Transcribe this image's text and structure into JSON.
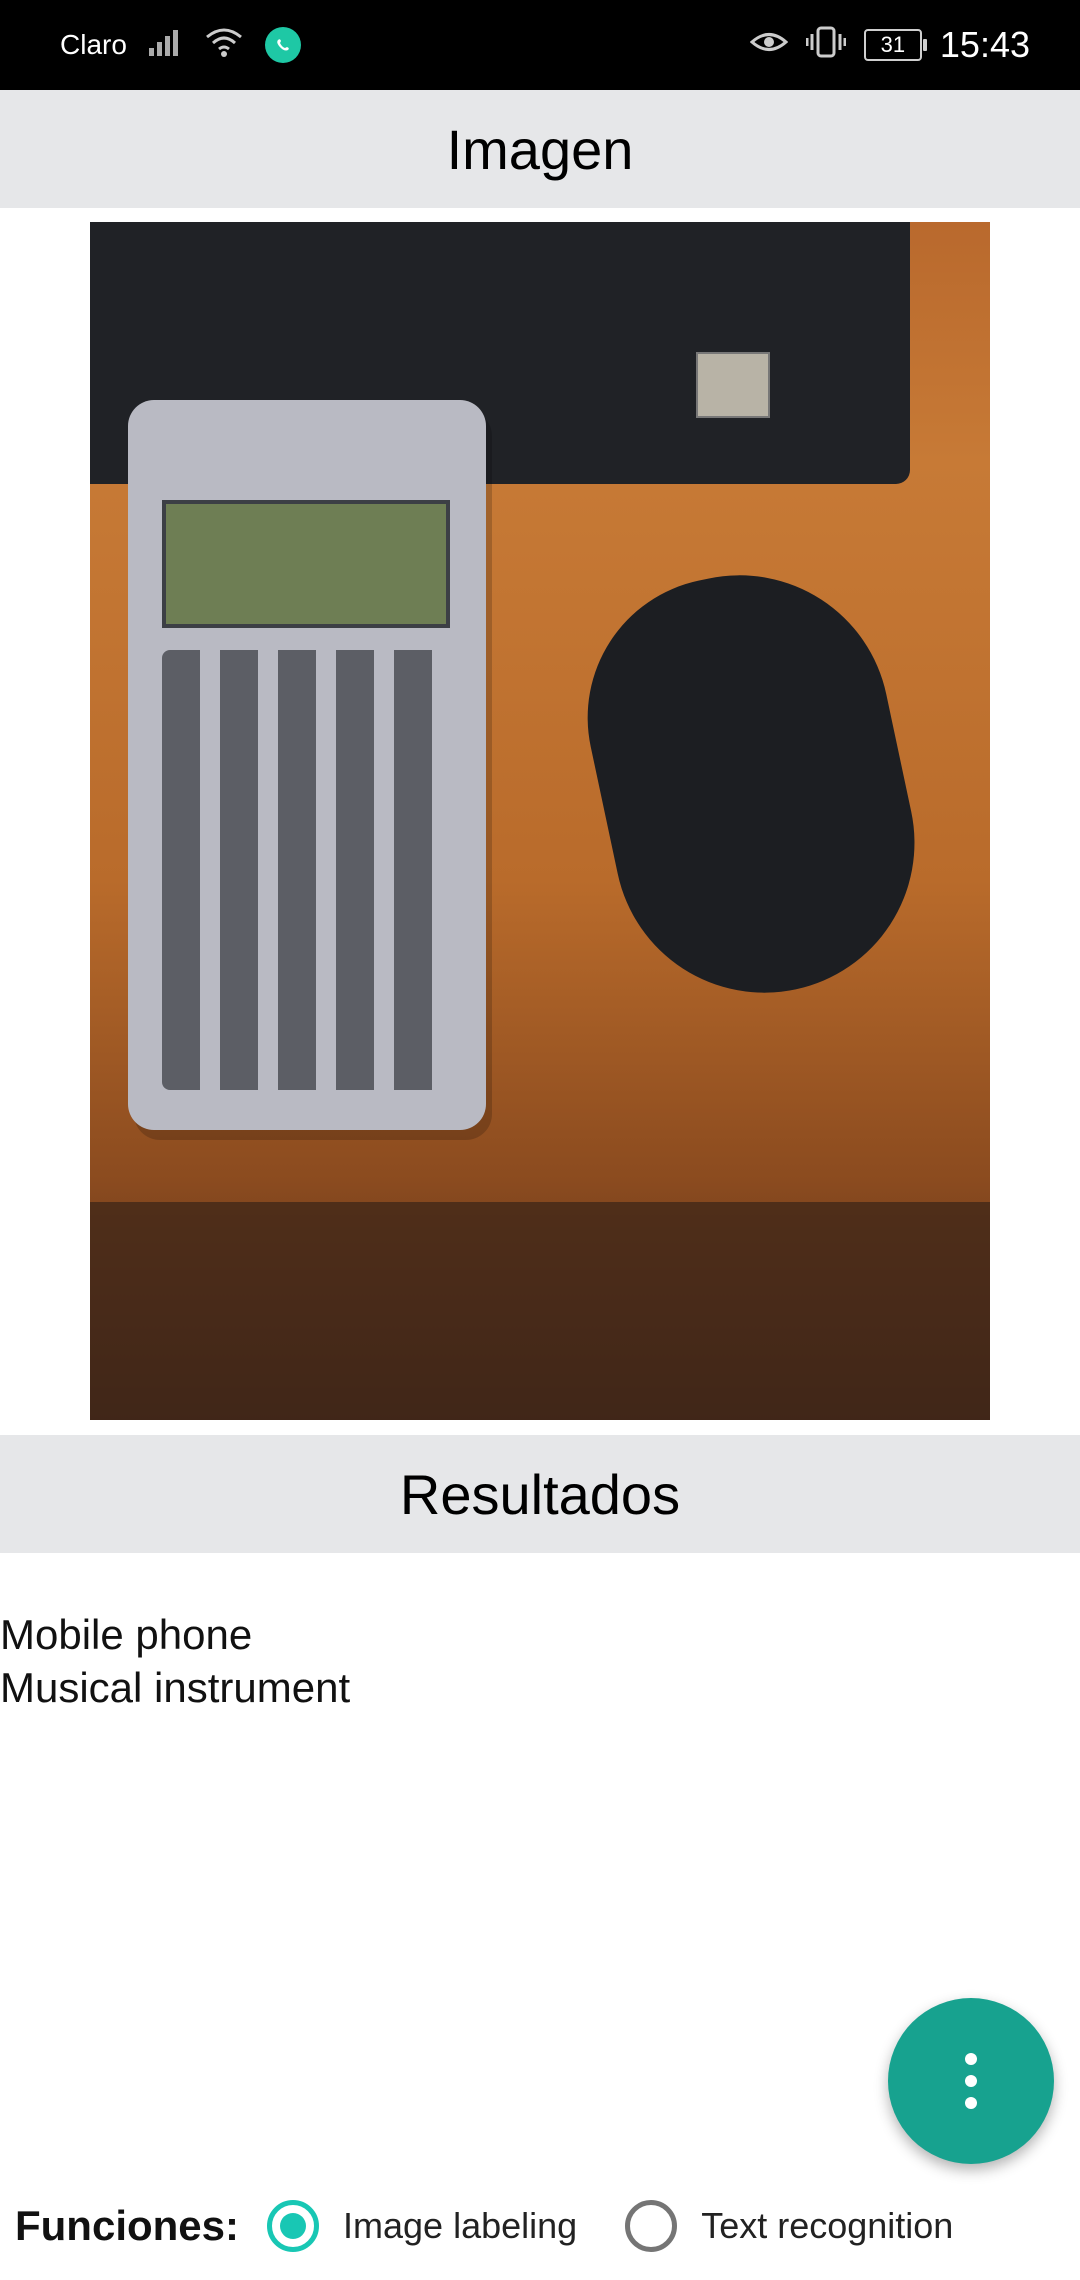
{
  "status_bar": {
    "carrier": "Claro",
    "battery": "31",
    "time": "15:43",
    "icons": [
      "signal-icon",
      "wifi-icon",
      "whatsapp-icon",
      "eye-icon",
      "vibrate-icon",
      "battery-icon"
    ]
  },
  "image_section": {
    "title": "Imagen"
  },
  "results_section": {
    "title": "Resultados",
    "items": [
      "Mobile phone",
      "Musical instrument"
    ]
  },
  "fab": {
    "icon": "more-vert-icon"
  },
  "functions": {
    "label": "Funciones:",
    "options": [
      {
        "label": "Image labeling",
        "selected": true
      },
      {
        "label": "Text recognition",
        "selected": false
      }
    ]
  },
  "colors": {
    "accent": "#17a28f",
    "radio_checked": "#18c7b4",
    "header_bg": "#e6e7e9"
  }
}
